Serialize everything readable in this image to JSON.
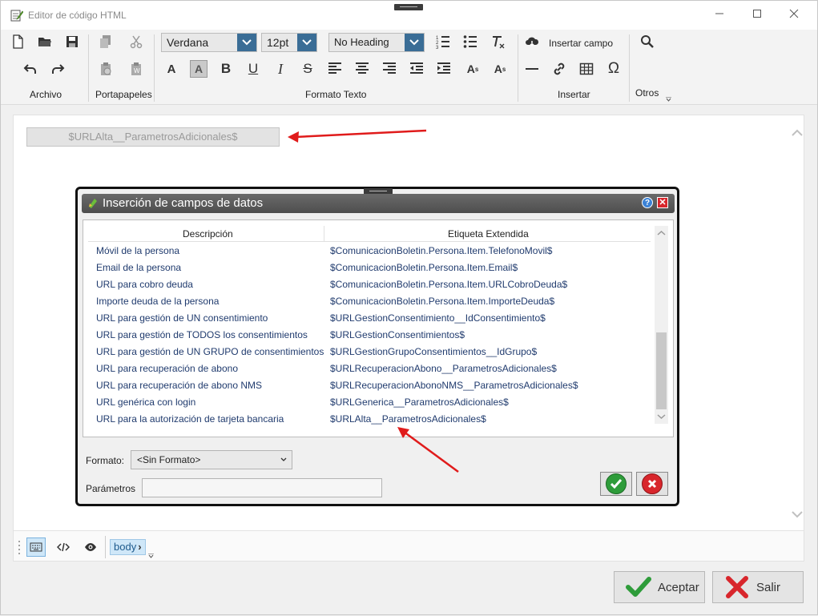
{
  "window": {
    "title": "Editor de código HTML",
    "controls": {
      "minimize": "—",
      "maximize": "☐",
      "close": "✕"
    }
  },
  "ribbon": {
    "font_family": "Verdana",
    "font_size": "12pt",
    "heading": "No Heading",
    "insert_field_label": "Insertar campo",
    "groups": {
      "archivo": "Archivo",
      "portapapeles": "Portapapeles",
      "formato_texto": "Formato Texto",
      "insertar": "Insertar",
      "otros": "Otros"
    },
    "glyphs": {
      "bold": "B",
      "underline": "U",
      "italic": "I",
      "strike": "S",
      "font_color": "A",
      "highlight": "A",
      "superscript": "A",
      "subscript": "A",
      "special_char": "Ω"
    }
  },
  "document": {
    "field_chip": "$URLAlta__ParametrosAdicionales$"
  },
  "statusbar": {
    "tag": "body",
    "tag_chevron": "›"
  },
  "dialog": {
    "title": "Inserción de campos de datos",
    "help_glyph": "?",
    "close_glyph": "✕",
    "columns": {
      "descripcion": "Descripción",
      "etiqueta": "Etiqueta Extendida"
    },
    "rows": [
      {
        "desc": "Móvil de la persona",
        "tag": "$ComunicacionBoletin.Persona.Item.TelefonoMovil$"
      },
      {
        "desc": "Email de la persona",
        "tag": "$ComunicacionBoletin.Persona.Item.Email$"
      },
      {
        "desc": "URL para cobro deuda",
        "tag": "$ComunicacionBoletin.Persona.Item.URLCobroDeuda$"
      },
      {
        "desc": "Importe deuda de la persona",
        "tag": "$ComunicacionBoletin.Persona.Item.ImporteDeuda$"
      },
      {
        "desc": "URL para gestión de UN consentimiento",
        "tag": "$URLGestionConsentimiento__IdConsentimiento$"
      },
      {
        "desc": "URL para gestión de TODOS los consentimientos",
        "tag": "$URLGestionConsentimientos$"
      },
      {
        "desc": "URL para gestión de UN GRUPO de consentimientos",
        "tag": "$URLGestionGrupoConsentimientos__IdGrupo$"
      },
      {
        "desc": "URL para recuperación de abono",
        "tag": "$URLRecuperacionAbono__ParametrosAdicionales$"
      },
      {
        "desc": "URL para recuperación de abono NMS",
        "tag": "$URLRecuperacionAbonoNMS__ParametrosAdicionales$"
      },
      {
        "desc": "URL genérica con login",
        "tag": "$URLGenerica__ParametrosAdicionales$"
      },
      {
        "desc": "URL para la autorización de tarjeta bancaria",
        "tag": "$URLAlta__ParametrosAdicionales$"
      }
    ],
    "formato_label": "Formato:",
    "formato_value": "<Sin Formato>",
    "parametros_label": "Parámetros",
    "parametros_value": ""
  },
  "footer": {
    "accept": "Aceptar",
    "exit": "Salir"
  },
  "colors": {
    "accent_blue": "#3a6d96",
    "row_text": "#203b6e",
    "annotation_red": "#e01b1b",
    "ok_green": "#2e9c3a",
    "cancel_red": "#d8262c"
  }
}
